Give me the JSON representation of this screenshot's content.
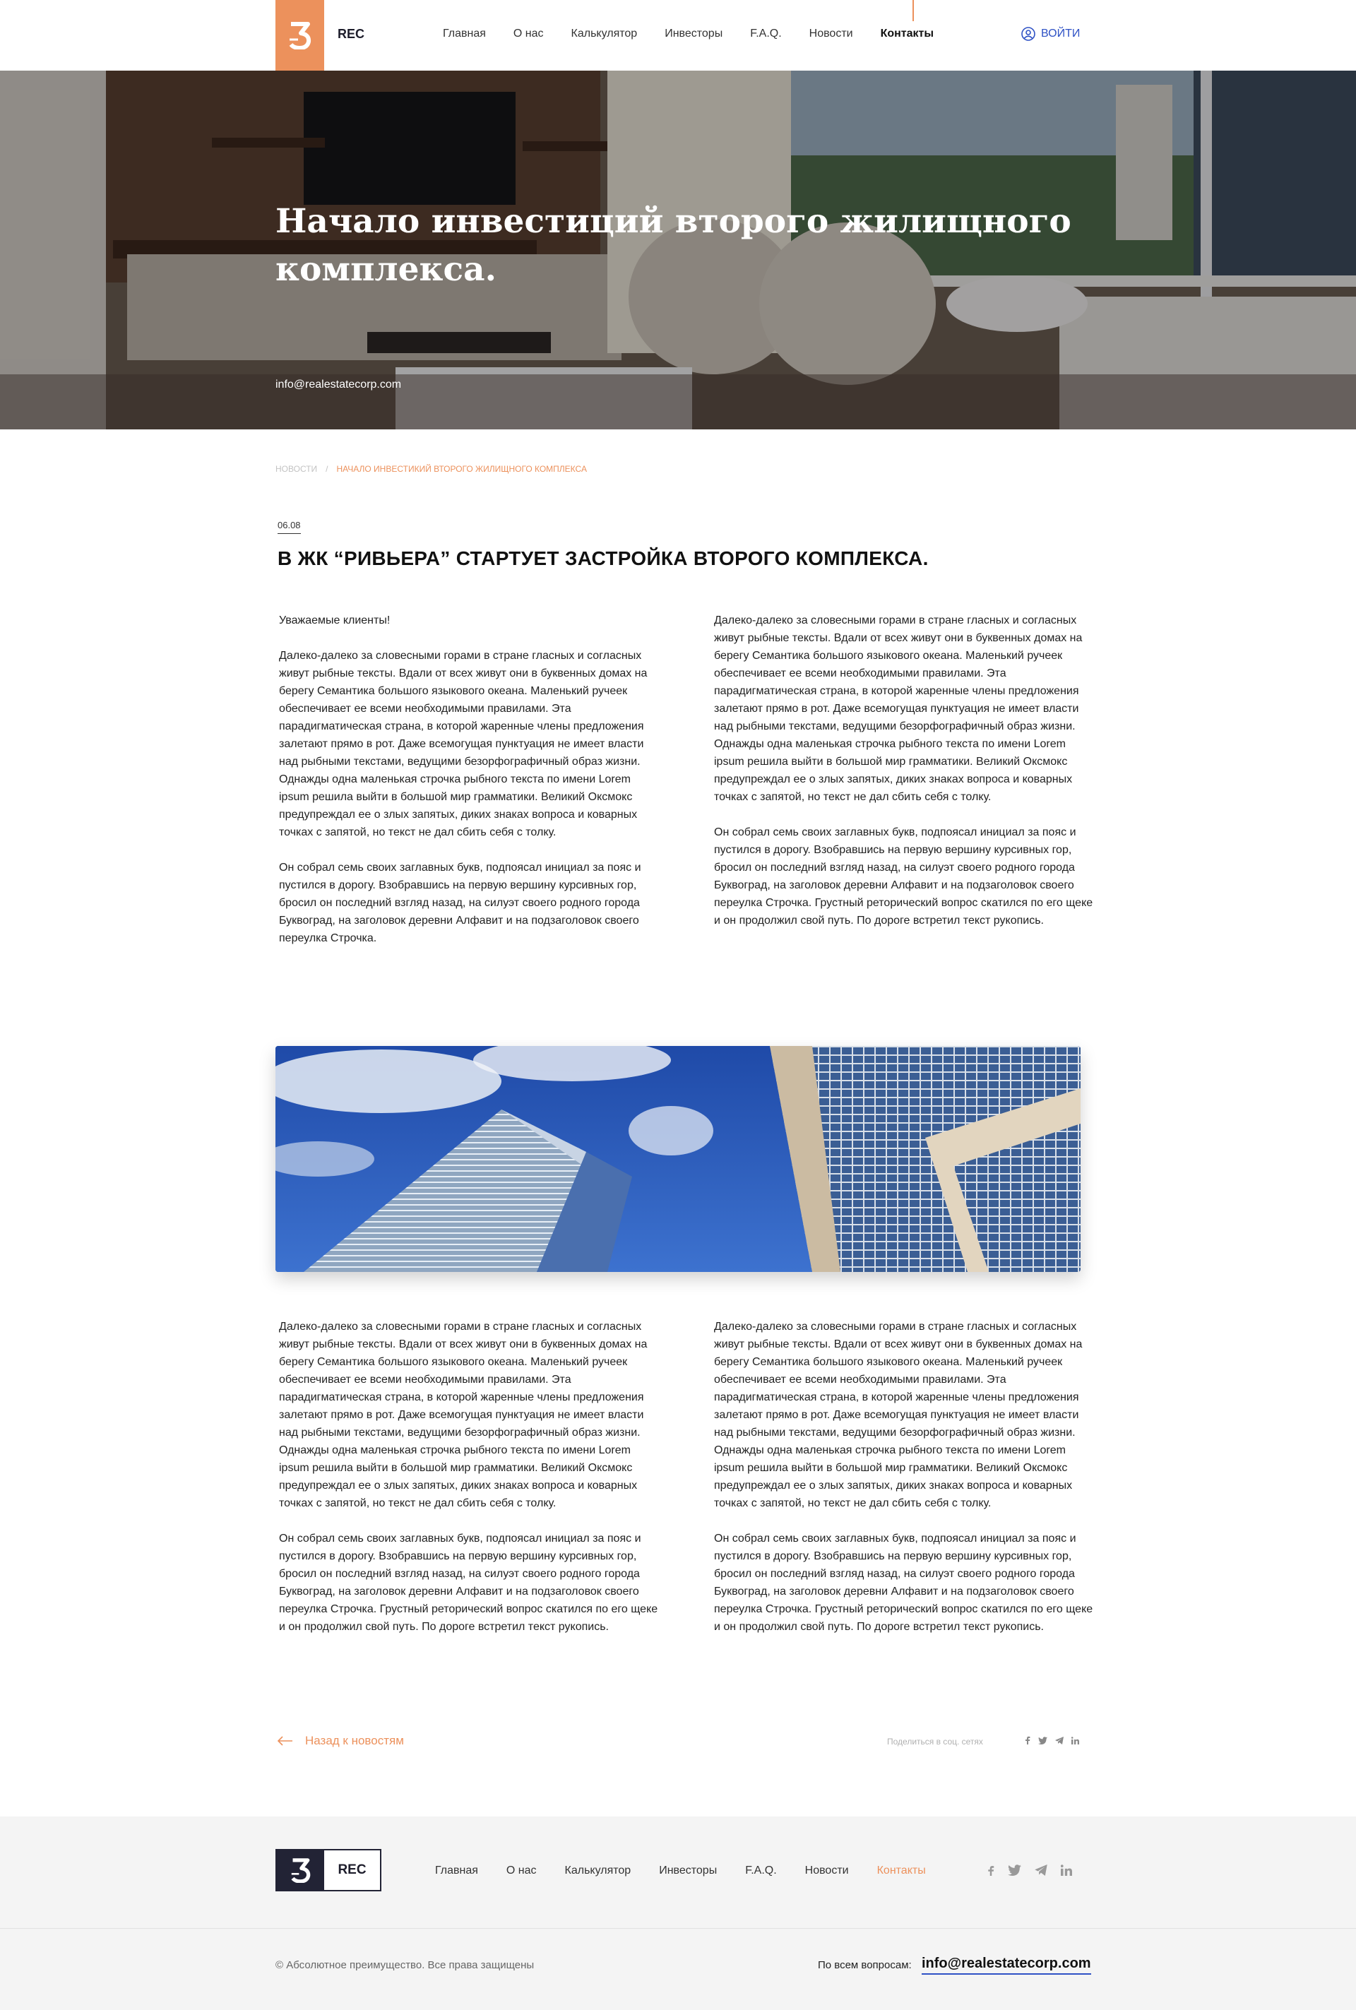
{
  "header": {
    "logo_letter": "3",
    "brand": "REC",
    "nav": [
      {
        "label": "Главная"
      },
      {
        "label": "О нас"
      },
      {
        "label": "Калькулятор"
      },
      {
        "label": "Инвесторы"
      },
      {
        "label": "F.A.Q."
      },
      {
        "label": "Новости"
      },
      {
        "label": "Контакты",
        "active": true
      }
    ],
    "login_label": "ВОЙТИ",
    "login_icon": "user-icon"
  },
  "hero": {
    "title": "Начало инвестиций второго жилищного комплекса.",
    "email": "info@realestatecorp.com"
  },
  "breadcrumb": {
    "root": "Новости",
    "separator": "/",
    "current": "Начало инвестикий второго жилищного комплекса"
  },
  "article": {
    "date": "06.08",
    "title": "В ЖК “РИВЬЕРА” СТАРТУЕТ ЗАСТРОЙКА ВТОРОГО КОМПЛЕКСА.",
    "section1": {
      "left": "Уважаемые клиенты!\n\nДалеко-далеко за словесными горами в стране гласных и согласных живут рыбные тексты. Вдали от всех живут они в буквенных домах на берегу Семантика большого языкового океана. Маленький ручеек\nобеспечивает ее всеми необходимыми правилами. Эта парадигматическая страна, в которой жаренные члены предложения залетают прямо в рот. Даже всемогущая пунктуация не имеет власти над рыбными текстами, ведущими безорфографичный образ жизни. Однажды одна маленькая строчка рыбного текста по имени Lorem ipsum решила выйти в большой мир грамматики. Великий Оксмокс предупреждал ее о злых запятых, диких знаках вопроса и коварных точках с запятой, но текст не дал сбить себя с толку.\n\nОн собрал семь своих заглавных букв, подпоясал инициал за пояс и пустился в дорогу. Взобравшись на первую вершину курсивных гор, бросил он последний взгляд назад, на силуэт своего родного города Буквоград, на заголовок деревни Алфавит и на подзаголовок своего переулка Строчка.",
      "right": "Далеко-далеко за словесными горами в стране гласных и согласных живут рыбные тексты. Вдали от всех живут они в буквенных домах на берегу Семантика большого языкового океана. Маленький ручеек\nобеспечивает ее всеми необходимыми правилами. Эта парадигматическая страна, в которой жаренные члены предложения залетают прямо в рот. Даже всемогущая пунктуация не имеет власти над рыбными текстами, ведущими безорфографичный образ жизни. Однажды одна маленькая строчка рыбного текста по имени Lorem ipsum решила выйти в большой мир грамматики. Великий Оксмокс предупреждал ее о злых запятых, диких знаках вопроса и коварных точках с запятой, но текст не дал сбить себя с толку.\n\nОн собрал семь своих заглавных букв, подпоясал инициал за пояс и пустился в дорогу. Взобравшись на первую вершину курсивных гор, бросил он последний взгляд назад, на силуэт своего родного города Буквоград, на заголовок деревни Алфавит и на подзаголовок своего переулка Строчка. Грустный реторический вопрос скатился по его щеке и он продолжил свой путь. По дороге встретил текст рукопись."
    },
    "section2": {
      "left": "Далеко-далеко за словесными горами в стране гласных и согласных живут рыбные тексты. Вдали от всех живут они в буквенных домах на берегу Семантика большого языкового океана. Маленький ручеек\nобеспечивает ее всеми необходимыми правилами. Эта парадигматическая страна, в которой жаренные члены предложения залетают прямо в рот. Даже всемогущая пунктуация не имеет власти над рыбными текстами, ведущими безорфографичный образ жизни. Однажды одна маленькая строчка рыбного текста по имени Lorem ipsum решила выйти в большой мир грамматики. Великий Оксмокс предупреждал ее о злых запятых, диких знаках вопроса и коварных точках с запятой, но текст не дал сбить себя с толку.\n\nОн собрал семь своих заглавных букв, подпоясал инициал за пояс и пустился в дорогу. Взобравшись на первую вершину курсивных гор, бросил он последний взгляд назад, на силуэт своего родного города Буквоград, на заголовок деревни Алфавит и на подзаголовок своего переулка Строчка. Грустный реторический вопрос скатился по его щеке и он продолжил свой путь. По дороге встретил текст рукопись.",
      "right": "Далеко-далеко за словесными горами в стране гласных и согласных живут рыбные тексты. Вдали от всех живут они в буквенных домах на берегу Семантика большого языкового океана. Маленький ручеек\nобеспечивает ее всеми необходимыми правилами. Эта парадигматическая страна, в которой жаренные члены предложения залетают прямо в рот. Даже всемогущая пунктуация не имеет власти над рыбными текстами, ведущими безорфографичный образ жизни. Однажды одна маленькая строчка рыбного текста по имени Lorem ipsum решила выйти в большой мир грамматики. Великий Оксмокс предупреждал ее о злых запятых, диких знаках вопроса и коварных точках с запятой, но текст не дал сбить себя с толку.\n\nОн собрал семь своих заглавных букв, подпоясал инициал за пояс и пустился в дорогу. Взобравшись на первую вершину курсивных гор, бросил он последний взгляд назад, на силуэт своего родного города Буквоград, на заголовок деревни Алфавит и на подзаголовок своего переулка Строчка. Грустный реторический вопрос скатился по его щеке и он продолжил свой путь. По дороге встретил текст рукопись."
    },
    "back_label": "Назад к новостям",
    "share_label": "Поделиться в соц. сетях",
    "share_icons": [
      "facebook-icon",
      "twitter-icon",
      "telegram-icon",
      "linkedin-icon"
    ]
  },
  "footer": {
    "logo_letter": "3",
    "brand": "REC",
    "nav": [
      {
        "label": "Главная"
      },
      {
        "label": "О нас"
      },
      {
        "label": "Калькулятор"
      },
      {
        "label": "Инвесторы"
      },
      {
        "label": "F.A.Q."
      },
      {
        "label": "Новости"
      },
      {
        "label": "Контакты",
        "active": true
      }
    ],
    "social_icons": [
      "facebook-icon",
      "twitter-icon",
      "telegram-icon",
      "linkedin-icon"
    ],
    "copyright": "© Абсолютное преимущество. Все права защищены",
    "contact_label": "По всем вопросам:",
    "contact_email": "info@realestatecorp.com"
  },
  "colors": {
    "accent": "#ec915c",
    "link": "#2f52c5",
    "dark": "#222335"
  }
}
